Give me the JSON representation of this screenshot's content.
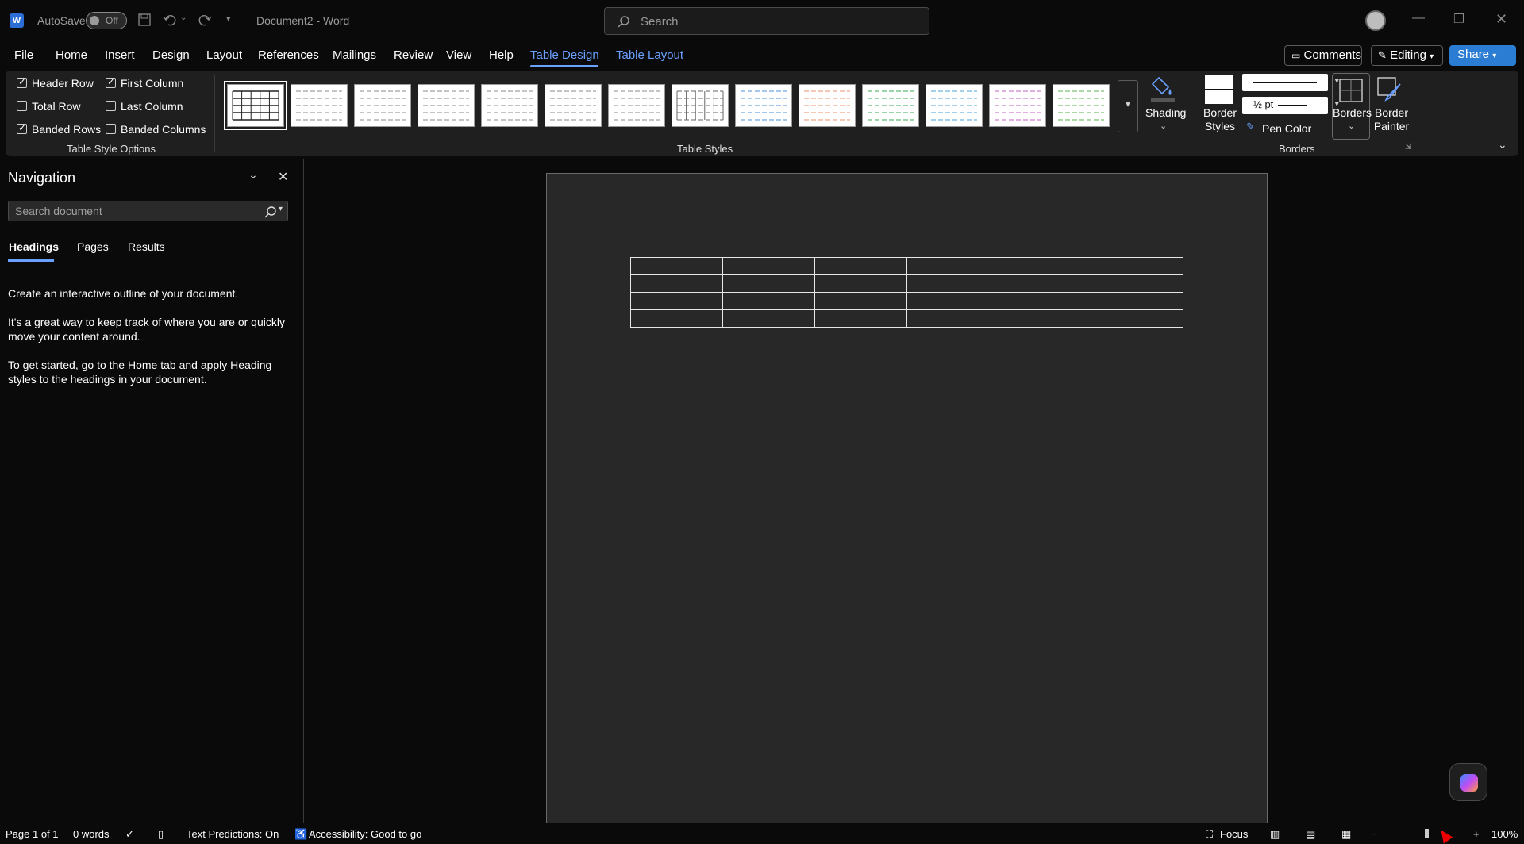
{
  "titlebar": {
    "app_icon": "W",
    "autosave_label": "AutoSave",
    "autosave_state": "Off",
    "doc_title": "Document2 - Word",
    "search_placeholder": "Search"
  },
  "tabs": [
    {
      "label": "File"
    },
    {
      "label": "Home"
    },
    {
      "label": "Insert"
    },
    {
      "label": "Design"
    },
    {
      "label": "Layout"
    },
    {
      "label": "References"
    },
    {
      "label": "Mailings"
    },
    {
      "label": "Review"
    },
    {
      "label": "View"
    },
    {
      "label": "Help"
    },
    {
      "label": "Table Design",
      "active": true
    },
    {
      "label": "Table Layout"
    }
  ],
  "header_buttons": {
    "comments": "Comments",
    "editing": "Editing",
    "share": "Share"
  },
  "ribbon": {
    "style_options": {
      "items": [
        {
          "label": "Header Row",
          "checked": true
        },
        {
          "label": "Total Row",
          "checked": false
        },
        {
          "label": "Banded Rows",
          "checked": true
        },
        {
          "label": "First Column",
          "checked": true
        },
        {
          "label": "Last Column",
          "checked": false
        },
        {
          "label": "Banded Columns",
          "checked": false
        }
      ],
      "group_label": "Table Style Options"
    },
    "table_styles": {
      "group_label": "Table Styles",
      "thumbnail_line_colors": [
        "#222222",
        "#888888",
        "#888888",
        "#888888",
        "#888888",
        "#888888",
        "#888888",
        "#666666",
        "#4a90d9",
        "#e8906a",
        "#3aaa55",
        "#4aa0d9",
        "#c060c0",
        "#5ab050"
      ]
    },
    "shading": "Shading",
    "borders_group": {
      "border_styles": "Border Styles",
      "line_weight": "½ pt",
      "pen_color": "Pen Color",
      "borders": "Borders",
      "border_painter": "Border Painter",
      "group_label": "Borders"
    }
  },
  "navigation": {
    "title": "Navigation",
    "search_placeholder": "Search document",
    "tabs": [
      "Headings",
      "Pages",
      "Results"
    ],
    "active_tab": "Headings",
    "paragraphs": [
      "Create an interactive outline of your document.",
      "It's a great way to keep track of where you are or quickly move your content around.",
      "To get started, go to the Home tab and apply Heading styles to the headings in your document."
    ]
  },
  "document": {
    "table_rows": 4,
    "table_cols": 6
  },
  "statusbar": {
    "page": "Page 1 of 1",
    "words": "0 words",
    "text_predictions": "Text Predictions: On",
    "accessibility": "Accessibility: Good to go",
    "focus": "Focus",
    "zoom": "100%"
  },
  "colors": {
    "accent": "#6aa0ff",
    "share": "#2b7cd3",
    "page": "#282828"
  }
}
